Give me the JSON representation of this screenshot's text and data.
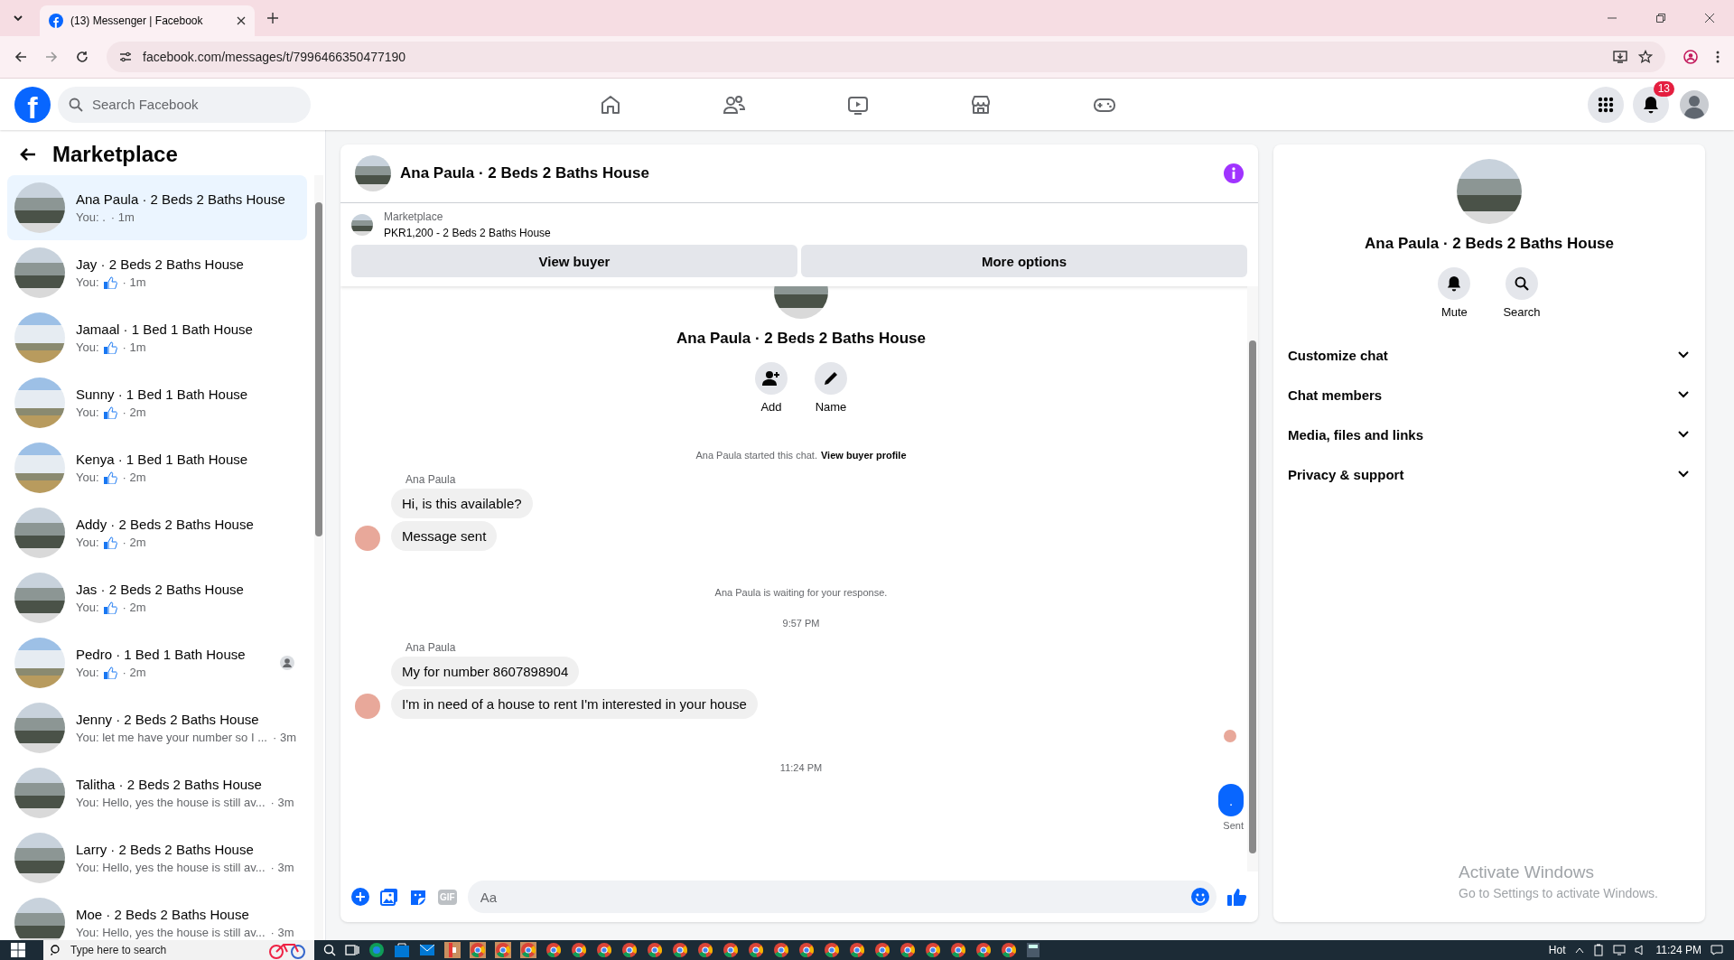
{
  "browser": {
    "tab_title": "(13) Messenger | Facebook",
    "url": "facebook.com/messages/t/7996466350477190"
  },
  "header": {
    "logo": "f",
    "search": {
      "placeholder": "Search Facebook"
    },
    "notification_count": "13"
  },
  "sidebar": {
    "title": "Marketplace",
    "conversations": [
      {
        "name": "Ana Paula · 2 Beds 2 Baths House",
        "kind": "text",
        "preview": "You: .",
        "time": "· 1m",
        "tall_house": false,
        "selected": true,
        "seen_avatar": false
      },
      {
        "name": "Jay · 2 Beds 2 Baths House",
        "kind": "like",
        "preview": "You:",
        "time": "· 1m",
        "tall_house": false,
        "selected": false,
        "seen_avatar": false
      },
      {
        "name": "Jamaal · 1 Bed 1 Bath House",
        "kind": "like",
        "preview": "You:",
        "time": "· 1m",
        "tall_house": true,
        "selected": false,
        "seen_avatar": false
      },
      {
        "name": "Sunny · 1 Bed 1 Bath House",
        "kind": "like",
        "preview": "You:",
        "time": "· 2m",
        "tall_house": true,
        "selected": false,
        "seen_avatar": false
      },
      {
        "name": "Kenya · 1 Bed 1 Bath House",
        "kind": "like",
        "preview": "You:",
        "time": "· 2m",
        "tall_house": true,
        "selected": false,
        "seen_avatar": false
      },
      {
        "name": "Addy · 2 Beds 2 Baths House",
        "kind": "like",
        "preview": "You:",
        "time": "· 2m",
        "tall_house": false,
        "selected": false,
        "seen_avatar": false
      },
      {
        "name": "Jas · 2 Beds 2 Baths House",
        "kind": "like",
        "preview": "You:",
        "time": "· 2m",
        "tall_house": false,
        "selected": false,
        "seen_avatar": false
      },
      {
        "name": "Pedro · 1 Bed 1 Bath House",
        "kind": "like",
        "preview": "You:",
        "time": "· 2m",
        "tall_house": true,
        "selected": false,
        "seen_avatar": true
      },
      {
        "name": "Jenny · 2 Beds 2 Baths House",
        "kind": "text",
        "preview": "You: let me have your number so I ...",
        "time": "· 3m",
        "tall_house": false,
        "selected": false,
        "seen_avatar": false
      },
      {
        "name": "Talitha · 2 Beds 2 Baths House",
        "kind": "text",
        "preview": "You: Hello, yes the house is still av...",
        "time": "· 3m",
        "tall_house": false,
        "selected": false,
        "seen_avatar": false
      },
      {
        "name": "Larry · 2 Beds 2 Baths House",
        "kind": "text",
        "preview": "You: Hello, yes the house is still av...",
        "time": "· 3m",
        "tall_house": false,
        "selected": false,
        "seen_avatar": false
      },
      {
        "name": "Moe · 2 Beds 2 Baths House",
        "kind": "text",
        "preview": "You: Hello, yes the house is still av...",
        "time": "· 3m",
        "tall_house": false,
        "selected": false,
        "seen_avatar": false
      }
    ]
  },
  "chat": {
    "title": "Ana Paula · 2 Beds 2 Baths House",
    "listing": {
      "label": "Marketplace",
      "text": "PKR1,200 - 2 Beds 2 Baths House",
      "buttons": [
        "View buyer",
        "More options"
      ]
    },
    "profile": {
      "title": "Ana Paula · 2 Beds 2 Baths House",
      "actions": [
        {
          "kind": "add",
          "label": "Add"
        },
        {
          "kind": "name",
          "label": "Name"
        }
      ]
    },
    "thread": [
      {
        "kind": "notice",
        "text": "Ana Paula started this chat.",
        "link": "View buyer profile"
      },
      {
        "kind": "group",
        "sender": "Ana Paula",
        "bubbles": [
          "Hi, is this available?",
          "Message sent"
        ]
      },
      {
        "kind": "notice",
        "text": "Ana Paula is waiting for your response."
      },
      {
        "kind": "time",
        "text": "9:57 PM"
      },
      {
        "kind": "group",
        "sender": "Ana Paula",
        "bubbles": [
          "My for number 8607898904",
          "I'm in need of a house to rent I'm interested in your house"
        ]
      },
      {
        "kind": "receipt"
      },
      {
        "kind": "time",
        "text": "11:24 PM"
      },
      {
        "kind": "outgoing",
        "text": ".",
        "status": "Sent"
      }
    ],
    "composer": {
      "placeholder": "Aa",
      "gif": "GIF"
    }
  },
  "details": {
    "title": "Ana Paula · 2 Beds 2 Baths House",
    "actions": [
      {
        "kind": "mute",
        "label": "Mute"
      },
      {
        "kind": "search",
        "label": "Search"
      }
    ],
    "sections": [
      {
        "label": "Customize chat",
        "expanded": false
      },
      {
        "label": "Chat members",
        "expanded": false
      },
      {
        "label": "Media, files and links",
        "expanded": false
      },
      {
        "label": "Privacy & support",
        "expanded": false
      }
    ]
  },
  "os_notice": {
    "title": "Activate Windows",
    "text": "Go to Settings to activate Windows."
  },
  "taskbar": {
    "search_placeholder": "Type here to search",
    "weather": "Hot",
    "time": "11:24 PM"
  }
}
